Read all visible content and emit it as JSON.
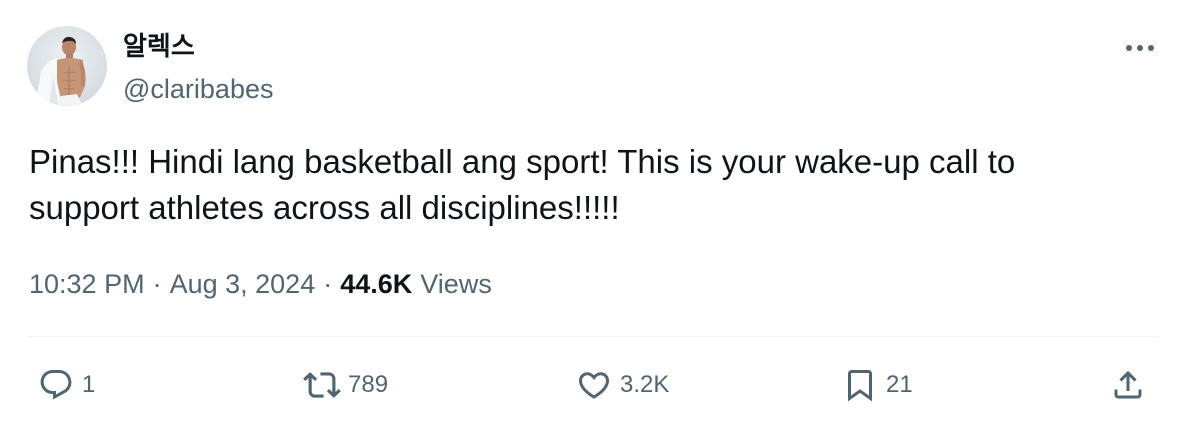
{
  "author": {
    "display_name": "알렉스",
    "handle": "@claribabes"
  },
  "tweet": {
    "text": "Pinas!!! Hindi lang basketball ang sport! This is your wake-up call to\nsupport athletes across all disciplines!!!!!",
    "time": "10:32 PM",
    "separator": "·",
    "date": "Aug 3, 2024",
    "views_count": "44.6K",
    "views_label": "Views"
  },
  "actions": {
    "replies": "1",
    "reposts": "789",
    "likes": "3.2K",
    "bookmarks": "21"
  },
  "icons": {
    "more": "more-horizontal-icon",
    "reply": "reply-bubble-icon",
    "repost": "repost-arrows-icon",
    "like": "heart-icon",
    "bookmark": "bookmark-icon",
    "share": "share-upload-icon"
  },
  "colors": {
    "text_primary": "#0f1419",
    "text_secondary": "#536471",
    "divider": "#eff3f4"
  }
}
